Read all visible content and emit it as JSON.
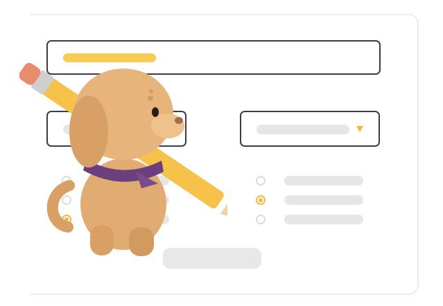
{
  "form": {
    "title_field": {
      "placeholder_color": "#f7cb55"
    },
    "select_field": {
      "caret_icon": "chevron-down-icon",
      "caret_color": "#f4b93b"
    },
    "right_options": [
      {
        "selected": false
      },
      {
        "selected": true
      },
      {
        "selected": false
      }
    ],
    "left_options": [
      {
        "selected": false
      },
      {
        "selected": false
      },
      {
        "selected": true
      }
    ],
    "accent_color": "#f4b93b",
    "border_color": "#3a3a4a"
  },
  "illustration": {
    "subject": "mascot-dog-with-pencil-icon"
  }
}
